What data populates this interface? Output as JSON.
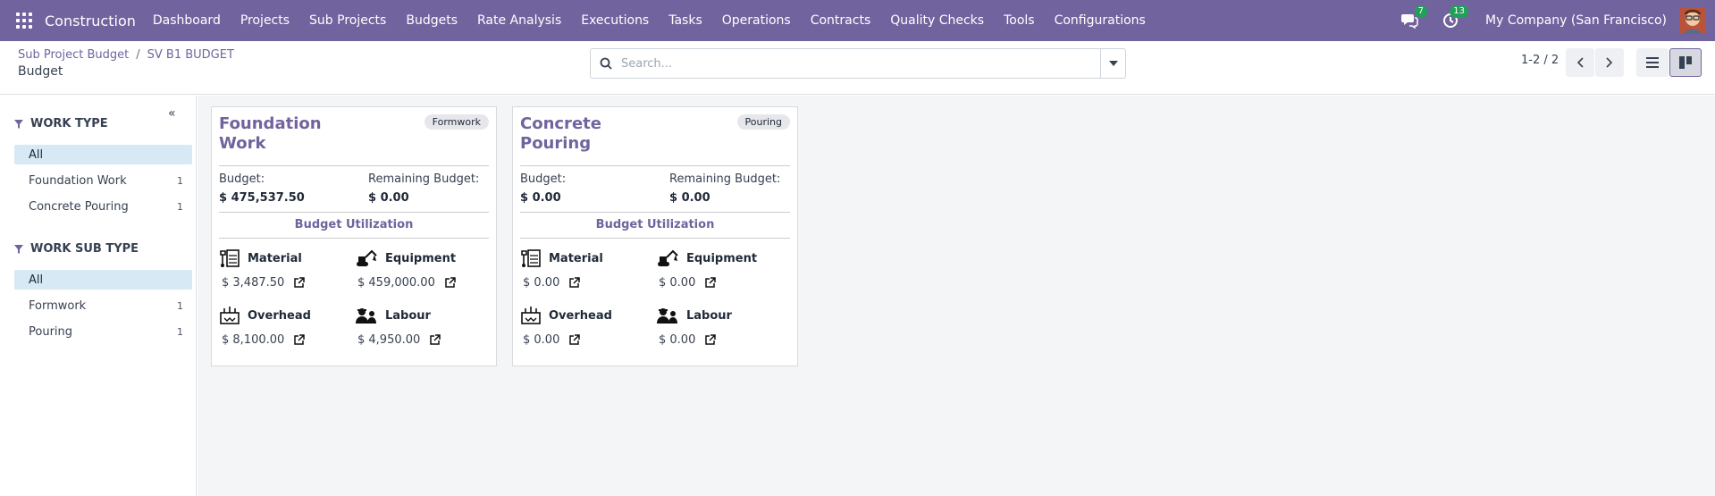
{
  "navbar": {
    "brand": "Construction",
    "menu": [
      "Dashboard",
      "Projects",
      "Sub Projects",
      "Budgets",
      "Rate Analysis",
      "Executions",
      "Tasks",
      "Operations",
      "Contracts",
      "Quality Checks",
      "Tools",
      "Configurations"
    ],
    "messages_count": "7",
    "activities_count": "13",
    "company": "My Company (San Francisco)",
    "brand_color": "#71639e"
  },
  "control": {
    "breadcrumb": [
      "Sub Project Budget",
      "SV B1 BUDGET"
    ],
    "breadcrumb_sep": "/",
    "title": "Budget",
    "search_placeholder": "Search...",
    "pager": "1-2 / 2"
  },
  "sidebar": {
    "sections": [
      {
        "heading": "WORK TYPE",
        "items": [
          {
            "label": "All",
            "count": "",
            "active": true
          },
          {
            "label": "Foundation Work",
            "count": "1",
            "active": false
          },
          {
            "label": "Concrete Pouring",
            "count": "1",
            "active": false
          }
        ]
      },
      {
        "heading": "WORK SUB TYPE",
        "items": [
          {
            "label": "All",
            "count": "",
            "active": true
          },
          {
            "label": "Formwork",
            "count": "1",
            "active": false
          },
          {
            "label": "Pouring",
            "count": "1",
            "active": false
          }
        ]
      }
    ]
  },
  "labels": {
    "budget": "Budget:",
    "remaining": "Remaining Budget:",
    "utilization": "Budget Utilization",
    "material": "Material",
    "equipment": "Equipment",
    "overhead": "Overhead",
    "labour": "Labour"
  },
  "cards": [
    {
      "title": "Foundation Work",
      "tag": "Formwork",
      "budget": "$ 475,537.50",
      "remaining": "$ 0.00",
      "material": "$ 3,487.50",
      "equipment": "$ 459,000.00",
      "overhead": "$ 8,100.00",
      "labour": "$ 4,950.00"
    },
    {
      "title": "Concrete Pouring",
      "tag": "Pouring",
      "budget": "$ 0.00",
      "remaining": "$ 0.00",
      "material": "$ 0.00",
      "equipment": "$ 0.00",
      "overhead": "$ 0.00",
      "labour": "$ 0.00"
    }
  ]
}
